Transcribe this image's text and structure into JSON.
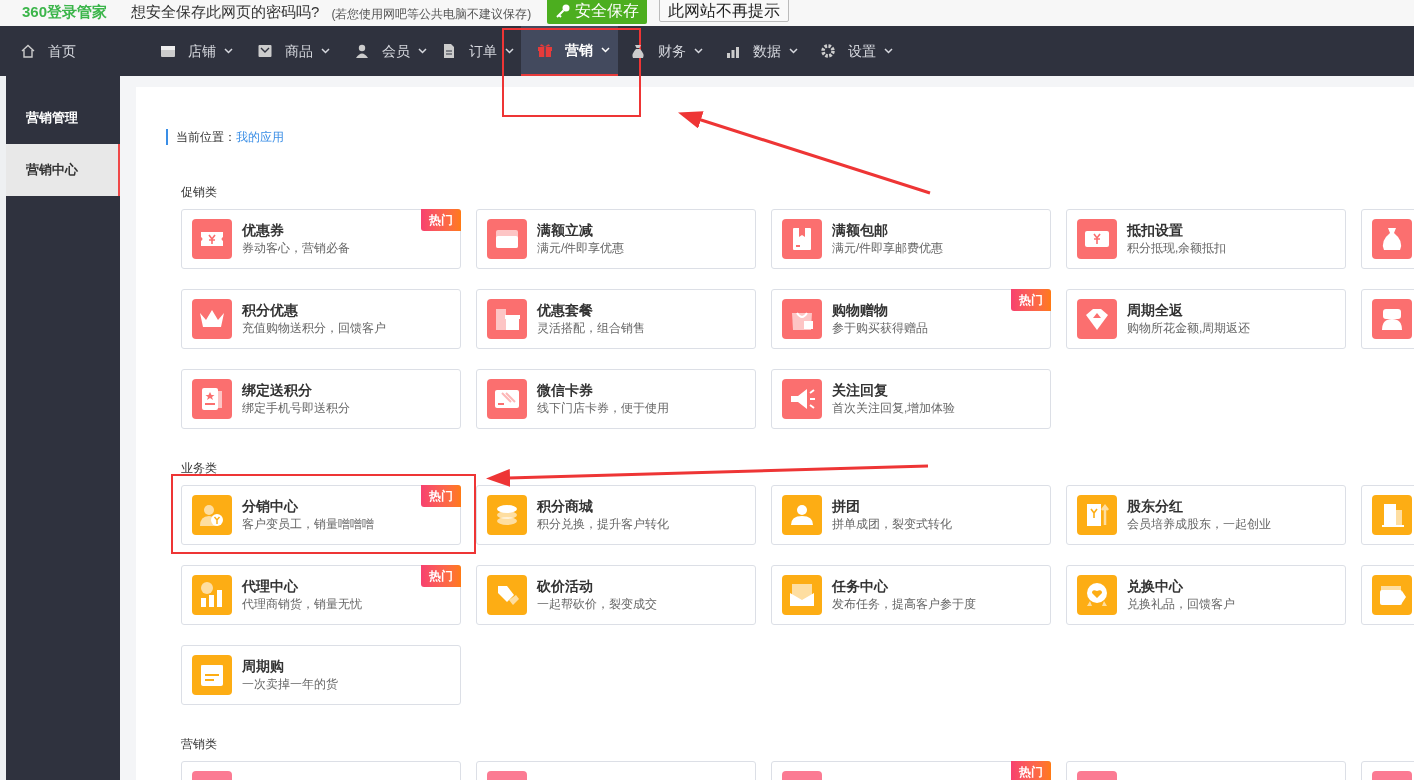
{
  "password_bar": {
    "logo": "360登录管家",
    "prompt": "想安全保存此网页的密码吗?",
    "note": "(若您使用网吧等公共电脑不建议保存)",
    "save_button": "安全保存",
    "dismiss_button": "此网站不再提示"
  },
  "nav": [
    {
      "label": "首页",
      "dropdown": false,
      "selected": false
    },
    {
      "label": "店铺",
      "dropdown": true,
      "selected": false
    },
    {
      "label": "商品",
      "dropdown": true,
      "selected": false
    },
    {
      "label": "会员",
      "dropdown": true,
      "selected": false
    },
    {
      "label": "订单",
      "dropdown": true,
      "selected": false
    },
    {
      "label": "营销",
      "dropdown": true,
      "selected": true,
      "annotated": true
    },
    {
      "label": "财务",
      "dropdown": true,
      "selected": false
    },
    {
      "label": "数据",
      "dropdown": true,
      "selected": false
    },
    {
      "label": "设置",
      "dropdown": true,
      "selected": false
    }
  ],
  "sidebar": {
    "header": "营销管理",
    "items": [
      {
        "label": "营销中心",
        "selected": true
      }
    ]
  },
  "breadcrumb": {
    "label": "当前位置：",
    "link": "我的应用"
  },
  "sections": [
    {
      "title": "促销类",
      "color": "#fb6f6f",
      "cards": [
        {
          "kind": "app",
          "title": "优惠券",
          "desc": "券动客心，营销必备",
          "badge": "热门"
        },
        {
          "kind": "app",
          "title": "满额立减",
          "desc": "满元/件即享优惠"
        },
        {
          "kind": "app",
          "title": "满额包邮",
          "desc": "满元/件即享邮费优惠"
        },
        {
          "kind": "app",
          "title": "抵扣设置",
          "desc": "积分抵现,余额抵扣"
        },
        {
          "kind": "icon_only"
        },
        {
          "kind": "app",
          "title": "积分优惠",
          "desc": "充值购物送积分，回馈客户"
        },
        {
          "kind": "app",
          "title": "优惠套餐",
          "desc": "灵活搭配，组合销售"
        },
        {
          "kind": "app",
          "title": "购物赠物",
          "desc": "参于购买获得赠品",
          "badge": "热门"
        },
        {
          "kind": "app",
          "title": "周期全返",
          "desc": "购物所花金额,周期返还"
        },
        {
          "kind": "icon_only"
        },
        {
          "kind": "app",
          "title": "绑定送积分",
          "desc": "绑定手机号即送积分"
        },
        {
          "kind": "app",
          "title": "微信卡券",
          "desc": "线下门店卡券，便于使用"
        },
        {
          "kind": "app",
          "title": "关注回复",
          "desc": "首次关注回复,增加体验"
        }
      ]
    },
    {
      "title": "业务类",
      "color": "#fdad14",
      "cards": [
        {
          "kind": "app",
          "title": "分销中心",
          "desc": "客户变员工，销量噌噌噌",
          "badge": "热门",
          "annotated": true
        },
        {
          "kind": "app",
          "title": "积分商城",
          "desc": "积分兑换，提升客户转化"
        },
        {
          "kind": "app",
          "title": "拼团",
          "desc": "拼单成团，裂变式转化"
        },
        {
          "kind": "app",
          "title": "股东分红",
          "desc": "会员培养成股东，一起创业"
        },
        {
          "kind": "icon_only"
        },
        {
          "kind": "app",
          "title": "代理中心",
          "desc": "代理商销货，销量无忧",
          "badge": "热门"
        },
        {
          "kind": "app",
          "title": "砍价活动",
          "desc": "一起帮砍价，裂变成交"
        },
        {
          "kind": "app",
          "title": "任务中心",
          "desc": "发布任务，提高客户参于度"
        },
        {
          "kind": "app",
          "title": "兑换中心",
          "desc": "兑换礼品，回馈客户"
        },
        {
          "kind": "icon_only"
        },
        {
          "kind": "app",
          "title": "周期购",
          "desc": "一次卖掉一年的货"
        }
      ]
    },
    {
      "title": "营销类",
      "color": "#fb7b93",
      "cards": [
        {
          "kind": "icon_only"
        },
        {
          "kind": "icon_only"
        },
        {
          "kind": "icon_only",
          "badge": "热门"
        },
        {
          "kind": "icon_only"
        },
        {
          "kind": "icon_only"
        }
      ]
    }
  ]
}
